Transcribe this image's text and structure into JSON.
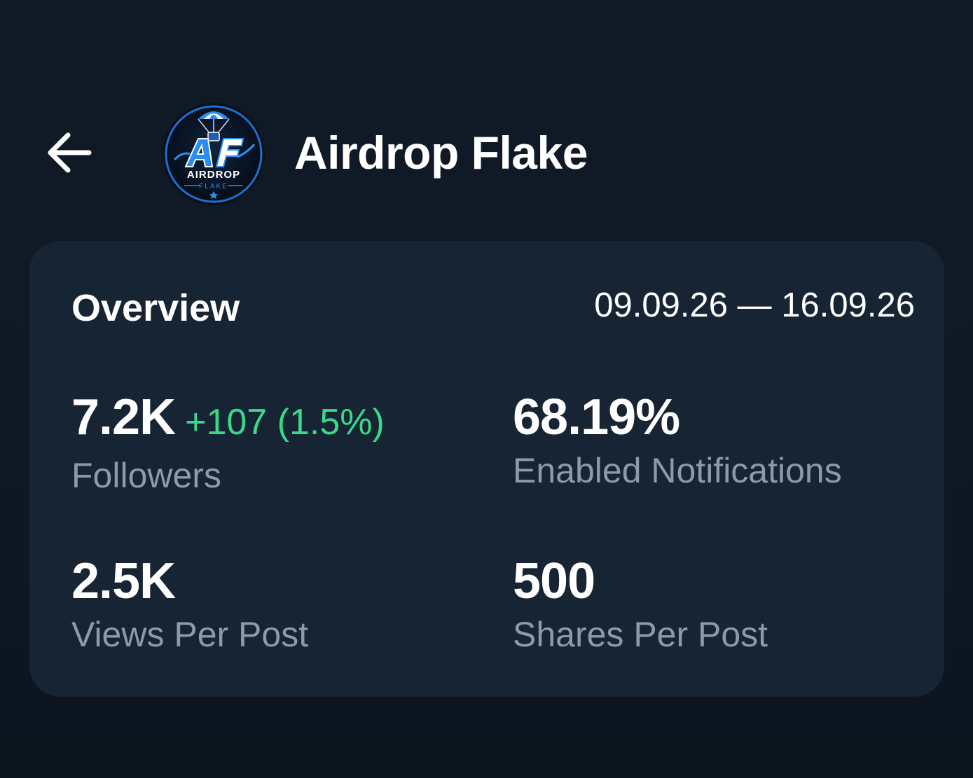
{
  "header": {
    "back_icon": "arrow-left-icon",
    "channel_name": "Airdrop Flake",
    "avatar": {
      "logo_text": "AIRDROP",
      "logo_subtext": "FLAKE",
      "logo_initials": "AF",
      "icon": "parachute-logo-icon"
    }
  },
  "overview": {
    "title": "Overview",
    "date_range": "09.09.26 — 16.09.26",
    "stats": {
      "followers": {
        "value": "7.2K",
        "delta": "+107 (1.5%)",
        "label": "Followers"
      },
      "notifications": {
        "value": "68.19%",
        "label": "Enabled Notifications"
      },
      "views": {
        "value": "2.5K",
        "label": "Views Per Post"
      },
      "shares": {
        "value": "500",
        "label": "Shares Per Post"
      }
    }
  },
  "colors": {
    "background": "#111b27",
    "card": "#172434",
    "positive_delta": "#3ad989",
    "label": "#8e9aa9",
    "logo_accent": "#2a8df0"
  }
}
